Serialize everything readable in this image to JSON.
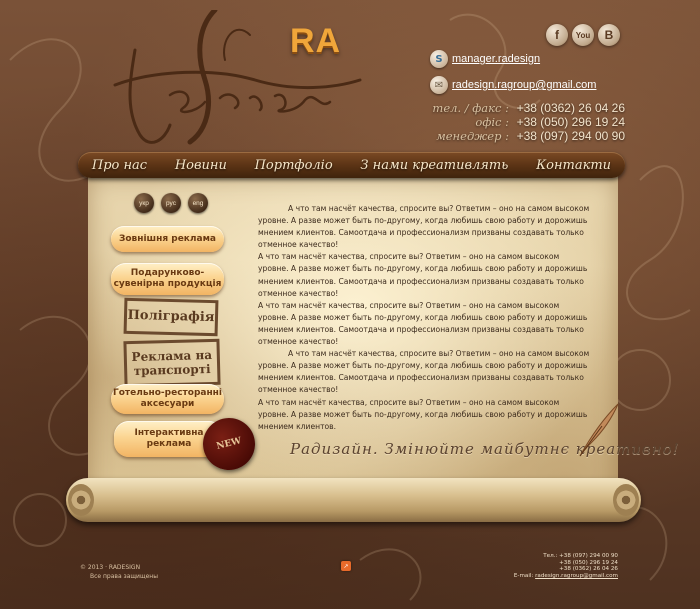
{
  "logo": {
    "ra": "RA"
  },
  "social": [
    {
      "name": "facebook",
      "glyph": "f"
    },
    {
      "name": "youtube",
      "glyph": "You"
    },
    {
      "name": "vkontakte",
      "glyph": "B"
    }
  ],
  "contacts": {
    "skype": "manager.radesign",
    "email": "radesign.ragroup@gmail.com"
  },
  "phones": [
    {
      "label": "тел. / факс :",
      "number": "+38 (0362) 26 04 26"
    },
    {
      "label": "офіс :",
      "number": "+38 (050) 296 19 24"
    },
    {
      "label": "менеджер :",
      "number": "+38 (097) 294 00 90"
    }
  ],
  "nav": [
    "Про нас",
    "Новини",
    "Портфоліо",
    "З нами креативлять",
    "Контакти"
  ],
  "languages": [
    "укр",
    "рус",
    "eng"
  ],
  "sidebar": {
    "outdoor": "Зовнішня реклама",
    "gifts": "Подарунково-сувенірна продукція",
    "print": "Поліграфія",
    "transport": "Реклама на транспорті",
    "horeca": "Готельно-ресторанні аксесуари",
    "interactive": "Інтерактивна реклама",
    "new_badge": "NEW"
  },
  "content": {
    "p1": "А что там насчёт качества, спросите вы? Ответим – оно на самом высоком уровне. А разве может быть по-другому, когда любишь свою работу и дорожишь мнением клиентов. Самоотдача и профессионализм призваны создавать только отменное качество!",
    "p2": "А что там насчёт качества, спросите вы? Ответим – оно на самом высоком уровне. А разве может быть по-другому, когда любишь свою работу и дорожишь мнением клиентов. Самоотдача и профессионализм призваны создавать только отменное качество!",
    "p3": "А что там насчёт качества, спросите вы? Ответим – оно на самом высоком уровне. А разве может быть по-другому, когда любишь свою работу и дорожишь мнением клиентов. Самоотдача и профессионализм призваны создавать только отменное качество!",
    "p4": "А что там насчёт качества, спросите вы? Ответим – оно на самом высоком уровне. А разве может быть по-другому, когда любишь свою работу и дорожишь мнением клиентов. Самоотдача и профессионализм призваны создавать только отменное качество!",
    "p5": "А что там насчёт качества, спросите вы? Ответим – оно на самом высоком уровне. А разве может быть по-другому, когда любишь свою работу и дорожишь мнением клиентов."
  },
  "tagline": "Радизайн. Змінюйте майбутнє креативно!",
  "footer": {
    "copyright": "© 2013 · RADESIGN",
    "rights": "Все права защищены",
    "tel_label": "Тел.:",
    "tel1": "+38 (097) 294 00 90",
    "tel2": "+38 (050) 296 19 24",
    "tel3": "+38 (0362) 26 04 26",
    "email_label": "E-mail:",
    "email": "radesign.ragroup@gmail.com"
  }
}
